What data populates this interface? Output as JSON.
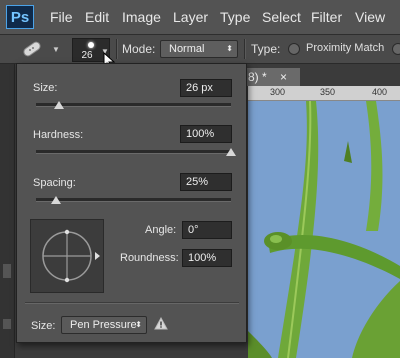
{
  "app": {
    "logo": "Ps"
  },
  "menu": [
    "File",
    "Edit",
    "Image",
    "Layer",
    "Type",
    "Select",
    "Filter",
    "View"
  ],
  "options_bar": {
    "brush_size": "26",
    "mode_label": "Mode:",
    "mode_value": "Normal",
    "type_label": "Type:",
    "type_option": "Proximity Match"
  },
  "document": {
    "tab_title": "8) *",
    "tab_close": "×",
    "ruler_ticks": [
      "300",
      "350",
      "400"
    ]
  },
  "brush_panel": {
    "size_label": "Size:",
    "size_value": "26 px",
    "size_level": 0.12,
    "hardness_label": "Hardness:",
    "hardness_value": "100%",
    "hardness_level": 1.0,
    "spacing_label": "Spacing:",
    "spacing_value": "25%",
    "spacing_level": 0.1,
    "angle_label": "Angle:",
    "angle_value": "0°",
    "roundness_label": "Roundness:",
    "roundness_value": "100%",
    "bottom_size_label": "Size:",
    "pressure_value": "Pen Pressure",
    "warning_icon": "warning-icon"
  },
  "colors": {
    "canvas_sky": "#6f97c8",
    "stem": "#6fa83a"
  }
}
